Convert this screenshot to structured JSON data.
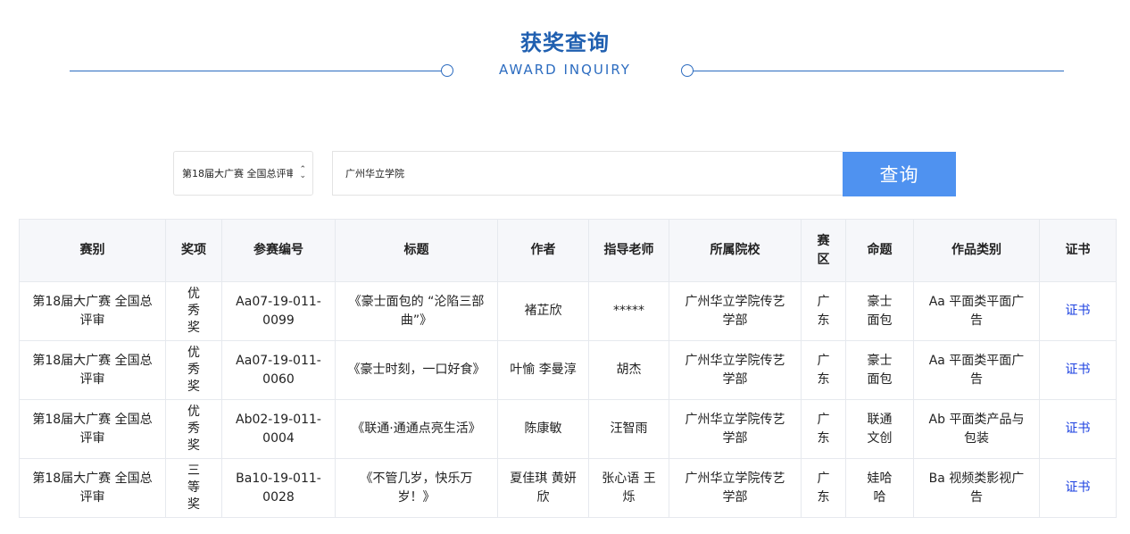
{
  "header": {
    "title": "获奖查询",
    "subtitle": "AWARD INQUIRY"
  },
  "search": {
    "competition_select": "第18届大广赛 全国总评审",
    "query_value": "广州华立学院",
    "button_label": "查询"
  },
  "table": {
    "columns": [
      "赛别",
      "奖项",
      "参赛编号",
      "标题",
      "作者",
      "指导老师",
      "所属院校",
      "赛区",
      "命题",
      "作品类别",
      "证书"
    ],
    "rows": [
      {
        "competition": "第18届大广赛 全国总评审",
        "award": "优秀奖",
        "entry_no": "Aa07-19-011-0099",
        "title": "《豪士面包的 “沦陷三部曲”》",
        "author": "褚芷欣",
        "advisor": "*****",
        "school": "广州华立学院传艺学部",
        "region": "广东",
        "topic": "豪士面包",
        "category": "Aa 平面类平面广告",
        "certificate": "证书"
      },
      {
        "competition": "第18届大广赛 全国总评审",
        "award": "优秀奖",
        "entry_no": "Aa07-19-011-0060",
        "title": "《豪士时刻，一口好食》",
        "author": "叶愉 李曼淳",
        "advisor": "胡杰",
        "school": "广州华立学院传艺学部",
        "region": "广东",
        "topic": "豪士面包",
        "category": "Aa 平面类平面广告",
        "certificate": "证书"
      },
      {
        "competition": "第18届大广赛 全国总评审",
        "award": "优秀奖",
        "entry_no": "Ab02-19-011-0004",
        "title": "《联通·通通点亮生活》",
        "author": "陈康敏",
        "advisor": "汪智雨",
        "school": "广州华立学院传艺学部",
        "region": "广东",
        "topic": "联通文创",
        "category": "Ab 平面类产品与包装",
        "certificate": "证书"
      },
      {
        "competition": "第18届大广赛 全国总评审",
        "award": "三等奖",
        "entry_no": "Ba10-19-011-0028",
        "title": "《不管几岁，快乐万岁！》",
        "author": "夏佳琪 黄妍欣",
        "advisor": "张心语 王烁",
        "school": "广州华立学院传艺学部",
        "region": "广东",
        "topic": "娃哈哈",
        "category": "Ba 视频类影视广告",
        "certificate": "证书"
      }
    ]
  },
  "colors": {
    "brand_blue": "#1f5fb0",
    "button_blue": "#4f92f0",
    "link_blue": "#1a3fe0"
  }
}
